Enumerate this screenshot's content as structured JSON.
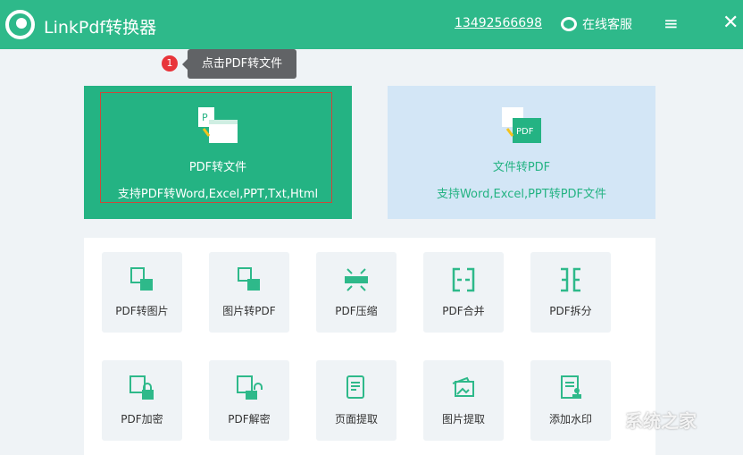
{
  "header": {
    "title": "LinkPdf转换器",
    "phone": "13492566698",
    "service": "在线客服",
    "menu_icon": "≡",
    "close_icon": "✕"
  },
  "tooltip": {
    "step": "1",
    "text": "点击PDF转文件"
  },
  "cards": [
    {
      "name": "PDF转文件",
      "desc": "支持PDF转Word,Excel,PPT,Txt,Html"
    },
    {
      "name": "文件转PDF",
      "desc": "支持Word,Excel,PPT转PDF文件",
      "icon_text": "PDF"
    }
  ],
  "tools": [
    {
      "label": "PDF转图片"
    },
    {
      "label": "图片转PDF"
    },
    {
      "label": "PDF压缩"
    },
    {
      "label": "PDF合并"
    },
    {
      "label": "PDF拆分"
    },
    {
      "label": "PDF加密"
    },
    {
      "label": "PDF解密"
    },
    {
      "label": "页面提取"
    },
    {
      "label": "图片提取"
    },
    {
      "label": "添加水印"
    }
  ],
  "watermark": "系统之家",
  "colors": {
    "brand": "#2eb98a",
    "card_active": "#24b383",
    "card_alt": "#d3e6f6"
  }
}
